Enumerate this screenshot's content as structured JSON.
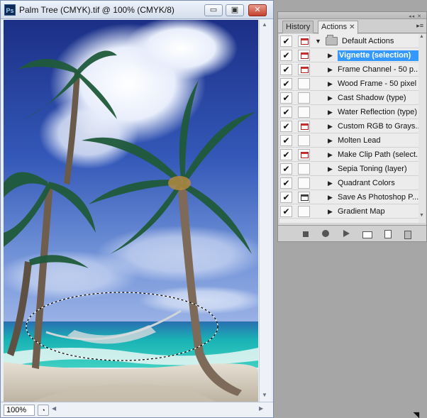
{
  "document": {
    "title": "Palm Tree (CMYK).tif @ 100% (CMYK/8)",
    "app_icon": "Ps",
    "buttons": {
      "minimize": "▭",
      "maximize": "▣",
      "close": "✕"
    },
    "zoom": "100%"
  },
  "panel": {
    "tabs": [
      {
        "label": "History",
        "active": false
      },
      {
        "label": "Actions",
        "active": true,
        "close": "✕"
      }
    ],
    "menu_icon": "▸≡",
    "set_name": "Default Actions",
    "actions": [
      {
        "label": "Vignette (selection)",
        "checked": true,
        "dialog": true,
        "selected": true
      },
      {
        "label": "Frame Channel - 50 p...",
        "checked": true,
        "dialog": true,
        "selected": false
      },
      {
        "label": "Wood Frame - 50 pixel",
        "checked": true,
        "dialog": false,
        "selected": false
      },
      {
        "label": "Cast Shadow (type)",
        "checked": true,
        "dialog": false,
        "selected": false
      },
      {
        "label": "Water Reflection (type)",
        "checked": true,
        "dialog": false,
        "selected": false
      },
      {
        "label": "Custom RGB to Grays...",
        "checked": true,
        "dialog": true,
        "selected": false
      },
      {
        "label": "Molten Lead",
        "checked": true,
        "dialog": false,
        "selected": false
      },
      {
        "label": "Make Clip Path (select...",
        "checked": true,
        "dialog": true,
        "selected": false
      },
      {
        "label": "Sepia Toning (layer)",
        "checked": true,
        "dialog": false,
        "selected": false
      },
      {
        "label": "Quadrant Colors",
        "checked": true,
        "dialog": false,
        "selected": false
      },
      {
        "label": "Save As Photoshop P...",
        "checked": true,
        "dialog": true,
        "selected": false
      },
      {
        "label": "Gradient Map",
        "checked": true,
        "dialog": false,
        "selected": false
      }
    ],
    "footer_buttons": [
      "stop-icon",
      "record-icon",
      "play-icon",
      "new-set-icon",
      "new-action-icon",
      "trash-icon"
    ]
  },
  "colors": {
    "selection_highlight": "#3399ff",
    "dialog_icon": "#cc3333"
  }
}
